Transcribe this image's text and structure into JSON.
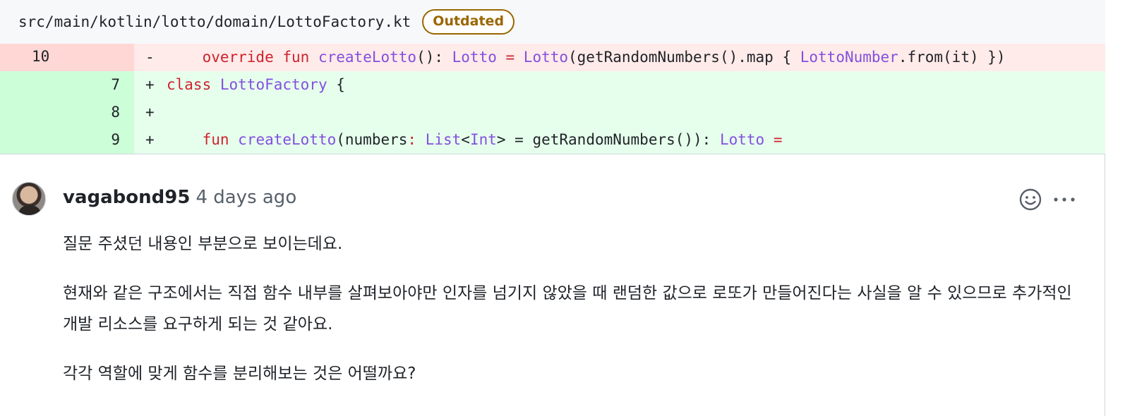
{
  "file": {
    "path": "src/main/kotlin/lotto/domain/LottoFactory.kt",
    "badge": "Outdated"
  },
  "diff": {
    "rows": [
      {
        "type": "del",
        "old_num": "10",
        "new_num": "",
        "marker": "-",
        "tokens": [
          {
            "t": "    ",
            "c": "tx"
          },
          {
            "t": "override",
            "c": "kw"
          },
          {
            "t": " ",
            "c": "tx"
          },
          {
            "t": "fun",
            "c": "kw"
          },
          {
            "t": " ",
            "c": "tx"
          },
          {
            "t": "createLotto",
            "c": "ty"
          },
          {
            "t": "(): ",
            "c": "tx"
          },
          {
            "t": "Lotto",
            "c": "ty"
          },
          {
            "t": " = ",
            "c": "kw"
          },
          {
            "t": "Lotto",
            "c": "ty"
          },
          {
            "t": "(getRandomNumbers().map { ",
            "c": "tx"
          },
          {
            "t": "LottoNumber",
            "c": "ty"
          },
          {
            "t": ".from(it) })",
            "c": "tx"
          }
        ]
      },
      {
        "type": "add",
        "old_num": "",
        "new_num": "7",
        "marker": "+",
        "tokens": [
          {
            "t": "class",
            "c": "kw"
          },
          {
            "t": " ",
            "c": "tx"
          },
          {
            "t": "LottoFactory",
            "c": "ty"
          },
          {
            "t": " {",
            "c": "tx"
          }
        ]
      },
      {
        "type": "add",
        "old_num": "",
        "new_num": "8",
        "marker": "+",
        "tokens": []
      },
      {
        "type": "add",
        "old_num": "",
        "new_num": "9",
        "marker": "+",
        "tokens": [
          {
            "t": "    ",
            "c": "tx"
          },
          {
            "t": "fun",
            "c": "kw"
          },
          {
            "t": " ",
            "c": "tx"
          },
          {
            "t": "createLotto",
            "c": "ty"
          },
          {
            "t": "(numbers",
            "c": "tx"
          },
          {
            "t": ":",
            "c": "kw"
          },
          {
            "t": " ",
            "c": "tx"
          },
          {
            "t": "List",
            "c": "ty"
          },
          {
            "t": "<",
            "c": "tx"
          },
          {
            "t": "Int",
            "c": "ty"
          },
          {
            "t": "> = getRandomNumbers()): ",
            "c": "tx"
          },
          {
            "t": "Lotto",
            "c": "ty"
          },
          {
            "t": " =",
            "c": "kw"
          }
        ]
      }
    ]
  },
  "comment": {
    "author": "vagabond95",
    "time": "4 days ago",
    "paragraphs": [
      "질문 주셨던 내용인 부분으로 보이는데요.",
      "현재와 같은 구조에서는 직접 함수 내부를 살펴보아야만 인자를 넘기지 않았을 때 랜덤한 값으로 로또가 만들어진다는 사실을 알 수 있으므로 추가적인 개발 리소스를 요구하게 되는 것 같아요.",
      "각각 역할에 맞게 함수를 분리해보는 것은 어떨까요?"
    ],
    "icons": {
      "reaction": "smiley-icon",
      "more": "kebab-horizontal-icon"
    }
  },
  "colors": {
    "keyword": "#cf222e",
    "type": "#8250df",
    "del_bg": "#ffebe9",
    "del_gutter": "#ffd7d5",
    "add_bg": "#e6ffec",
    "add_gutter": "#ccffd8",
    "badge": "#9a6700"
  }
}
